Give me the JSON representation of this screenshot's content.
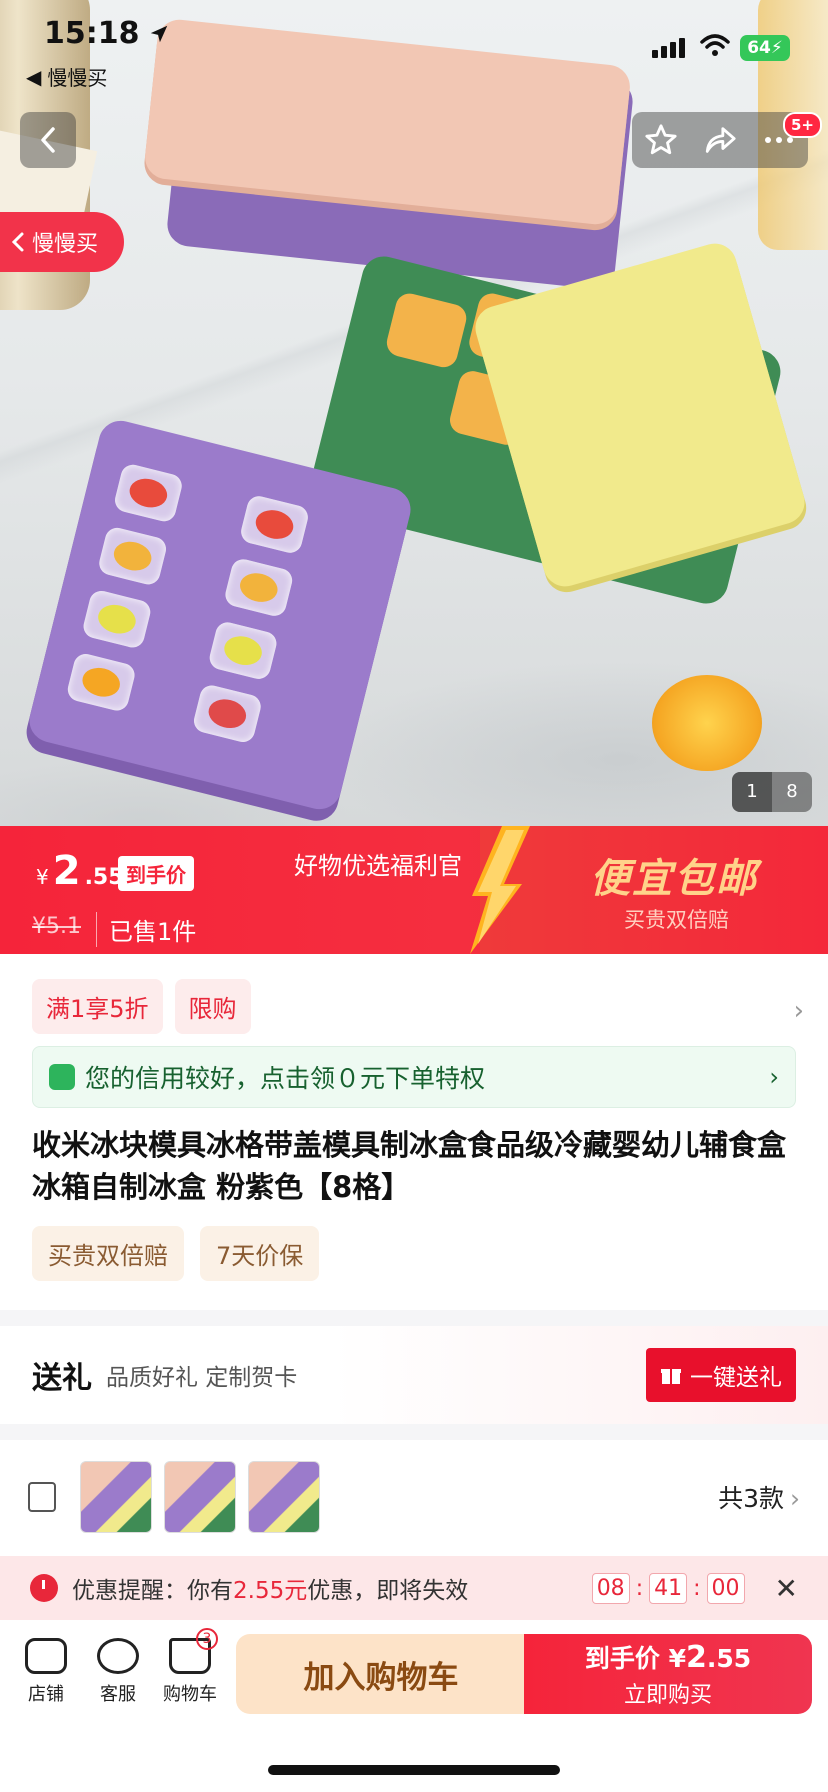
{
  "status_bar": {
    "time": "15:18",
    "back_app": "慢慢买",
    "battery": "64"
  },
  "hero": {
    "side_pill": "慢慢买",
    "notification_badge": "5+",
    "page_current": "1",
    "page_total": "8"
  },
  "price": {
    "currency": "¥",
    "integer": "2",
    "decimal": ".55",
    "tag": "到手价",
    "original": "¥5.1",
    "sold": "已售1件",
    "promo_title": "好物优选福利官",
    "slogan": "便宜包邮",
    "slogan_sub": "买贵双倍赔"
  },
  "promos": [
    "满1享5折",
    "限购"
  ],
  "credit": {
    "text": "您的信用较好，点击领０元下单特权"
  },
  "product": {
    "title": "收米冰块模具冰格带盖模具制冰盒食品级冷藏婴幼儿辅食盒冰箱自制冰盒 粉紫色【8格】"
  },
  "services": [
    "买贵双倍赔",
    "7天价保"
  ],
  "gift": {
    "title": "送礼",
    "sub": "品质好礼 定制贺卡",
    "button": "一键送礼"
  },
  "variants": {
    "count": "共3款"
  },
  "coupon": {
    "prefix": "优惠提醒：你有",
    "amount": "2.55元",
    "suffix": "优惠，即将失效",
    "hh": "08",
    "mm": "41",
    "ss": "00"
  },
  "bottom": {
    "shop": "店铺",
    "service": "客服",
    "cart": "购物车",
    "cart_count": "3",
    "add_cart": "加入购物车",
    "buy_l1_label": "到手价",
    "buy_currency": "¥",
    "buy_int": "2",
    "buy_dec": ".55",
    "buy_l2": "立即购买"
  },
  "colors": {
    "accent": "#f5243a",
    "credit_green": "#2db45c",
    "gold": "#ffd38a"
  }
}
